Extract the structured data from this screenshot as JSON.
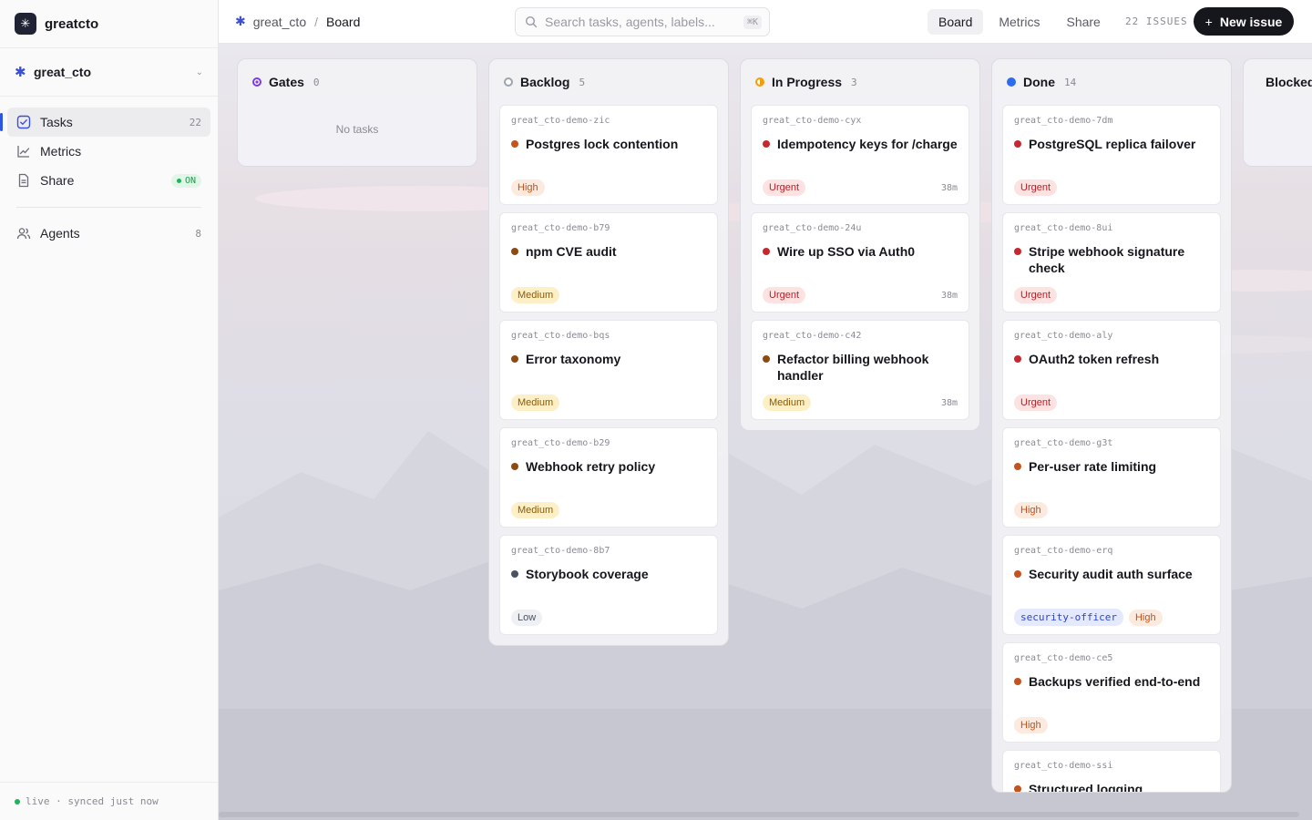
{
  "app": {
    "name": "greatcto",
    "logo_glyph": "✳"
  },
  "workspace": {
    "name": "great_cto",
    "icon": "asterisk-icon"
  },
  "sidebar": {
    "items": [
      {
        "label": "Tasks",
        "count": "22",
        "icon": "tasks-checkbox-icon",
        "active": true
      },
      {
        "label": "Metrics",
        "icon": "chart-line-icon"
      },
      {
        "label": "Share",
        "icon": "document-icon",
        "status": "ON"
      },
      {
        "label": "Agents",
        "count": "8",
        "icon": "users-icon"
      }
    ],
    "footer": "live · synced just now"
  },
  "topbar": {
    "breadcrumb": {
      "workspace": "great_cto",
      "separator": "/",
      "page": "Board"
    },
    "search": {
      "placeholder": "Search tasks, agents, labels...",
      "shortcut": "⌘K"
    },
    "tabs": [
      {
        "label": "Board",
        "active": true
      },
      {
        "label": "Metrics"
      },
      {
        "label": "Share"
      }
    ],
    "issues_count": "22 ISSUES",
    "new_issue_label": "New issue",
    "new_issue_icon": "plus-icon"
  },
  "colors": {
    "accent": "#2d55e6",
    "urgent": "#c6282e",
    "high": "#c4531c",
    "medium": "#8d4b12",
    "low": "#4a5263"
  },
  "badge_styles": {
    "Urgent": {
      "bg": "#fde2e2",
      "fg": "#b4232a"
    },
    "High": {
      "bg": "#fdeadf",
      "fg": "#c2521b"
    },
    "Medium": {
      "bg": "#fdf0c7",
      "fg": "#8a5a06"
    },
    "Low": {
      "bg": "#eef0f4",
      "fg": "#4a5263"
    },
    "security-officer": {
      "bg": "#e4e9fd",
      "fg": "#2f46c7"
    }
  },
  "columns": [
    {
      "title": "Gates",
      "count": "0",
      "dot": "#7c3aed",
      "ring": true,
      "empty_text": "No tasks",
      "cards": []
    },
    {
      "title": "Backlog",
      "count": "5",
      "dot": "#9ca3af",
      "ring": true,
      "cards": [
        {
          "id": "great_cto-demo-zic",
          "title": "Postgres lock contention",
          "priority": "High",
          "dot": "#c4531c",
          "badges": [
            "High"
          ]
        },
        {
          "id": "great_cto-demo-b79",
          "title": "npm CVE audit",
          "priority": "Medium",
          "dot": "#8d4b12",
          "badges": [
            "Medium"
          ]
        },
        {
          "id": "great_cto-demo-bqs",
          "title": "Error taxonomy",
          "priority": "Medium",
          "dot": "#8d4b12",
          "badges": [
            "Medium"
          ]
        },
        {
          "id": "great_cto-demo-b29",
          "title": "Webhook retry policy",
          "priority": "Medium",
          "dot": "#8d4b12",
          "badges": [
            "Medium"
          ]
        },
        {
          "id": "great_cto-demo-8b7",
          "title": "Storybook coverage",
          "priority": "Low",
          "dot": "#4a5263",
          "badges": [
            "Low"
          ]
        }
      ]
    },
    {
      "title": "In Progress",
      "count": "3",
      "dot": "#f59e0b",
      "ring": false,
      "half": true,
      "cards": [
        {
          "id": "great_cto-demo-cyx",
          "title": "Idempotency keys for /charge",
          "priority": "Urgent",
          "dot": "#c6282e",
          "badges": [
            "Urgent"
          ],
          "age": "38m"
        },
        {
          "id": "great_cto-demo-24u",
          "title": "Wire up SSO via Auth0",
          "priority": "Urgent",
          "dot": "#c6282e",
          "badges": [
            "Urgent"
          ],
          "age": "38m"
        },
        {
          "id": "great_cto-demo-c42",
          "title": "Refactor billing webhook handler",
          "priority": "Medium",
          "dot": "#8d4b12",
          "badges": [
            "Medium"
          ],
          "age": "38m"
        }
      ]
    },
    {
      "title": "Done",
      "count": "14",
      "dot": "#2d6cf0",
      "ring": false,
      "cards": [
        {
          "id": "great_cto-demo-7dm",
          "title": "PostgreSQL replica failover",
          "priority": "Urgent",
          "dot": "#c6282e",
          "badges": [
            "Urgent"
          ]
        },
        {
          "id": "great_cto-demo-8ui",
          "title": "Stripe webhook signature check",
          "priority": "Urgent",
          "dot": "#c6282e",
          "badges": [
            "Urgent"
          ]
        },
        {
          "id": "great_cto-demo-aly",
          "title": "OAuth2 token refresh",
          "priority": "Urgent",
          "dot": "#c6282e",
          "badges": [
            "Urgent"
          ]
        },
        {
          "id": "great_cto-demo-g3t",
          "title": "Per-user rate limiting",
          "priority": "High",
          "dot": "#c4531c",
          "badges": [
            "High"
          ]
        },
        {
          "id": "great_cto-demo-erq",
          "title": "Security audit auth surface",
          "priority": "High",
          "dot": "#c4531c",
          "badges": [
            "security-officer",
            "High"
          ]
        },
        {
          "id": "great_cto-demo-ce5",
          "title": "Backups verified end-to-end",
          "priority": "High",
          "dot": "#c4531c",
          "badges": [
            "High"
          ]
        },
        {
          "id": "great_cto-demo-ssi",
          "title": "Structured logging",
          "priority": "High",
          "dot": "#c4531c",
          "badges": []
        }
      ]
    },
    {
      "title": "Blocked",
      "count": "",
      "dot": "#dc2626",
      "ring": false,
      "cards": []
    }
  ]
}
